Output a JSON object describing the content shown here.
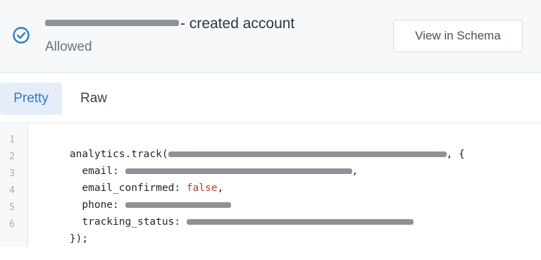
{
  "header": {
    "title_suffix": "- created account",
    "status_text": "Allowed",
    "view_button_label": "View in Schema",
    "status_icon": "check-circle-icon",
    "accent_color": "#2a7bd1"
  },
  "tabs": [
    {
      "label": "Pretty",
      "active": true
    },
    {
      "label": "Raw",
      "active": false
    }
  ],
  "code": {
    "line_numbers": [
      "1",
      "2",
      "3",
      "4",
      "5",
      "6"
    ],
    "line1_prefix": "analytics.track(",
    "line1_suffix": ", {",
    "line2_key": "email: ",
    "line2_suffix": ",",
    "line3_key": "email_confirmed: ",
    "line3_value": "false",
    "line3_suffix": ",",
    "line4_key": "phone: ",
    "line5_key": "tracking_status: ",
    "line6": "});"
  }
}
